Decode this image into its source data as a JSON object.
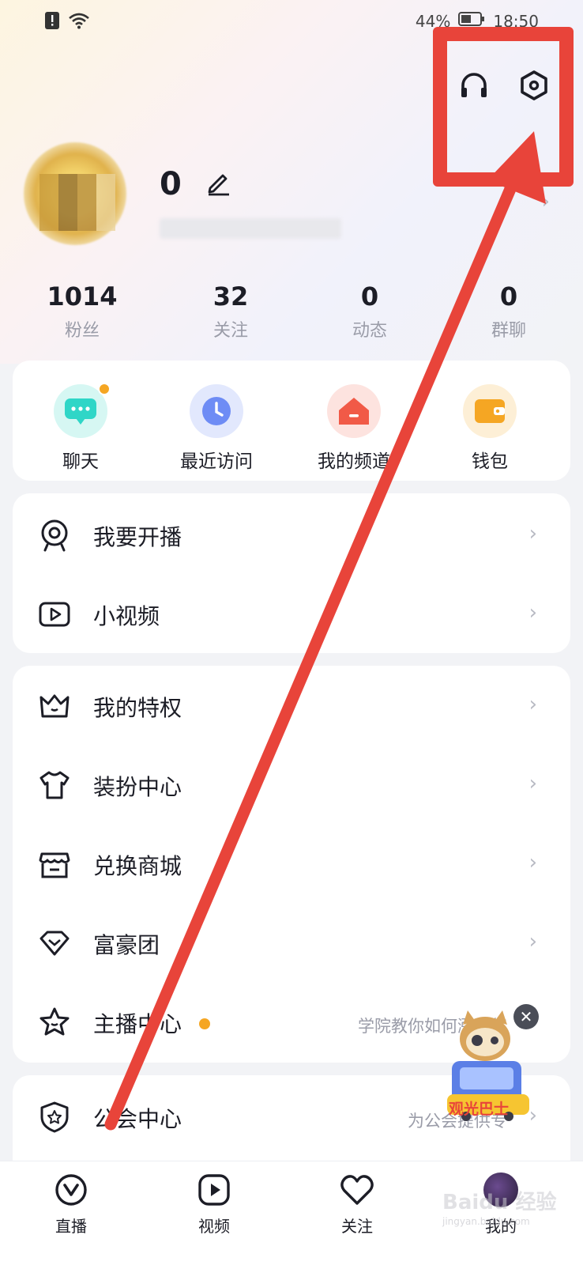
{
  "status_bar": {
    "battery": "44%",
    "time": "18:50",
    "icons": [
      "alert-icon",
      "wifi-icon",
      "battery-icon"
    ]
  },
  "header": {
    "actions": [
      {
        "name": "headset-icon"
      },
      {
        "name": "settings-icon"
      }
    ]
  },
  "profile": {
    "username": "0"
  },
  "stats": [
    {
      "value": "1014",
      "label": "粉丝"
    },
    {
      "value": "32",
      "label": "关注"
    },
    {
      "value": "0",
      "label": "动态"
    },
    {
      "value": "0",
      "label": "群聊"
    }
  ],
  "quick_actions": [
    {
      "label": "聊天",
      "icon": "chat-icon",
      "color": "#2fd6c7"
    },
    {
      "label": "最近访问",
      "icon": "clock-icon",
      "color": "#6e8cf5"
    },
    {
      "label": "我的频道",
      "icon": "channel-icon",
      "color": "#f15a47"
    },
    {
      "label": "钱包",
      "icon": "wallet-icon",
      "color": "#f5a623"
    }
  ],
  "menu_group_1": [
    {
      "label": "我要开播",
      "icon": "camera-icon"
    },
    {
      "label": "小视频",
      "icon": "video-icon"
    }
  ],
  "menu_group_2": [
    {
      "label": "我的特权",
      "icon": "crown-icon"
    },
    {
      "label": "装扮中心",
      "icon": "tshirt-icon"
    },
    {
      "label": "兑换商城",
      "icon": "store-icon"
    },
    {
      "label": "富豪团",
      "icon": "diamond-icon"
    },
    {
      "label": "主播中心",
      "icon": "star-icon",
      "subtitle": "学院教你如何涨人气"
    }
  ],
  "menu_group_3": [
    {
      "label": "公会中心",
      "icon": "guild-icon",
      "subtitle": "为公会提供专"
    }
  ],
  "mascot": {
    "label": "观光巴士"
  },
  "tabs": [
    {
      "label": "直播",
      "icon": "live-icon"
    },
    {
      "label": "视频",
      "icon": "play-icon"
    },
    {
      "label": "关注",
      "icon": "heart-icon"
    },
    {
      "label": "我的",
      "icon": "avatar-icon"
    }
  ],
  "watermark": {
    "text": "Baidu 经验",
    "sub": "jingyan.baidu.com"
  },
  "colors": {
    "accent_red": "#e8443a",
    "badge_orange": "#f5a623"
  }
}
